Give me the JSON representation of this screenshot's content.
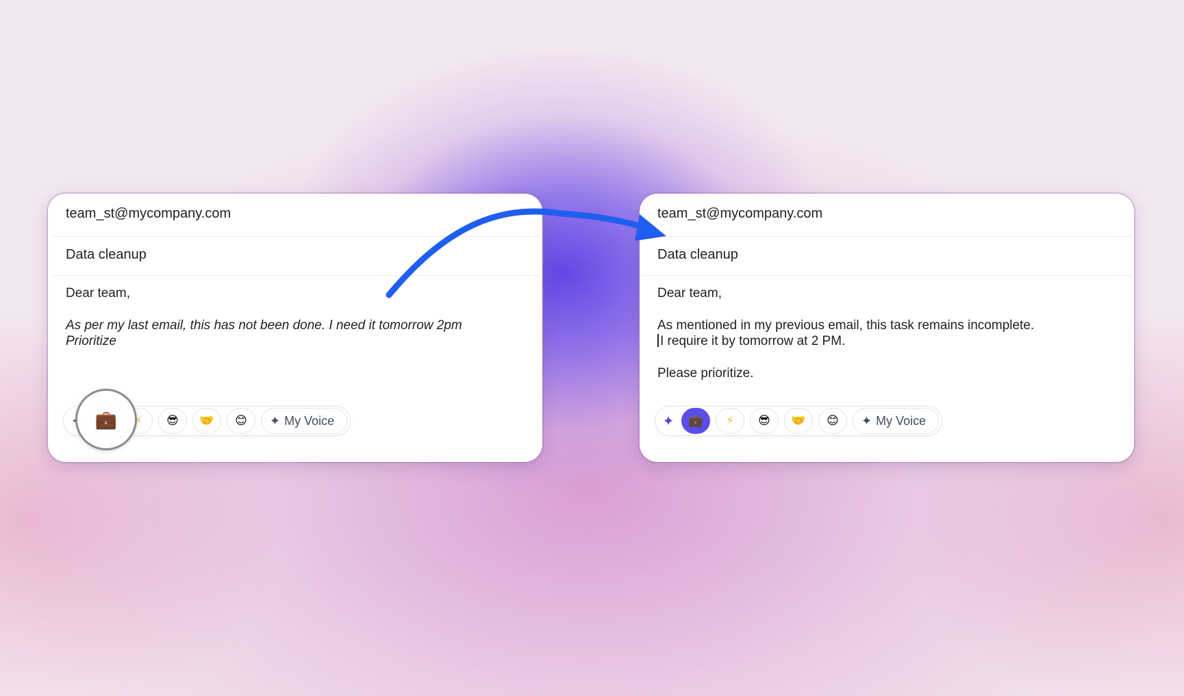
{
  "before": {
    "to": "team_st@mycompany.com",
    "subject": "Data cleanup",
    "greeting": "Dear team,",
    "body_line1": "As per my last email, this has not been done. I need it tomorrow 2pm",
    "body_line2": "Prioritize",
    "toolbar": {
      "sparkle": "✦",
      "professional": "💼",
      "concise": "⚡",
      "cool": "😎",
      "friendly": "🤝",
      "casual": "😊",
      "voice_star": "✦",
      "voice_label": "My Voice"
    },
    "highlight_icon": "💼"
  },
  "after": {
    "to": "team_st@mycompany.com",
    "subject": "Data cleanup",
    "greeting": "Dear team,",
    "body_line1": "As mentioned in my previous email, this task remains incomplete.",
    "body_line2": "I require it by tomorrow at 2 PM.",
    "body_line3": "Please prioritize.",
    "toolbar": {
      "sparkle": "✦",
      "professional": "💼",
      "concise": "⚡",
      "cool": "😎",
      "friendly": "🤝",
      "casual": "😊",
      "voice_star": "✦",
      "voice_label": "My Voice"
    },
    "active_tone": "professional"
  },
  "colors": {
    "accent": "#5b4ee6",
    "arrow": "#1f5ff0",
    "card_bg": "#ffffff",
    "page_bg": "#f2e6ef"
  }
}
